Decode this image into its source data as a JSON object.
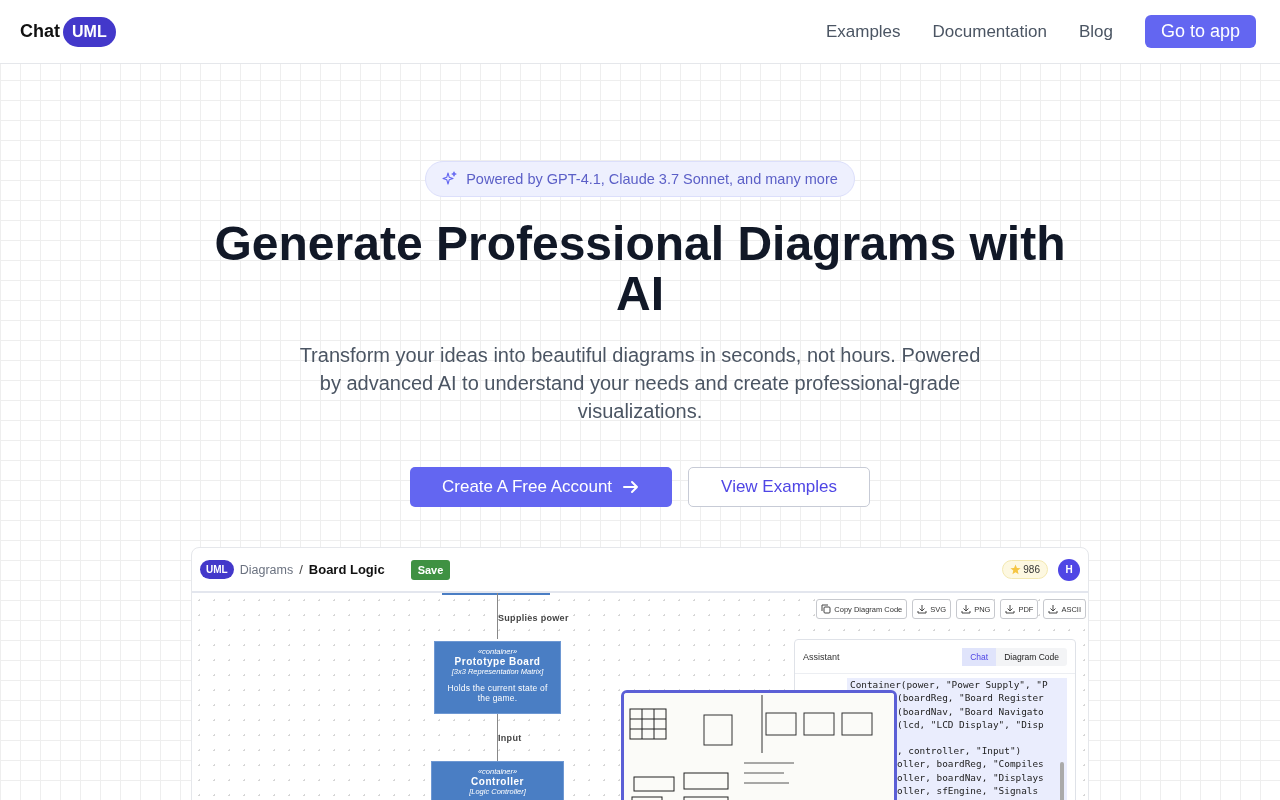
{
  "header": {
    "logo": {
      "word": "Chat",
      "badge": "UML"
    },
    "nav": [
      {
        "label": "Examples"
      },
      {
        "label": "Documentation"
      },
      {
        "label": "Blog"
      }
    ],
    "cta": "Go to app"
  },
  "hero": {
    "badge": "Powered by GPT-4.1, Claude 3.7 Sonnet, and many more",
    "title": "Generate Professional Diagrams with AI",
    "subtitle": "Transform your ideas into beautiful diagrams in seconds, not hours. Powered by advanced AI to understand your needs and create professional-grade visualizations.",
    "primary_button": "Create A Free Account",
    "secondary_button": "View Examples"
  },
  "preview": {
    "logo": "UML",
    "breadcrumb": "Diagrams",
    "separator": "/",
    "title": "Board Logic",
    "save": "Save",
    "credits": "986",
    "avatar": "H",
    "toolbar": [
      {
        "kind": "copy",
        "label": "Copy Diagram Code"
      },
      {
        "kind": "download",
        "label": "SVG"
      },
      {
        "kind": "download",
        "label": "PNG"
      },
      {
        "kind": "download",
        "label": "PDF"
      },
      {
        "kind": "download",
        "label": "ASCII"
      }
    ],
    "diagram": {
      "edges": [
        "Supplies power",
        "Input"
      ],
      "nodes": [
        {
          "stereotype": "«container»",
          "name": "Prototype Board",
          "tech": "[3x3 Representation Matrix]",
          "description": "Holds the current state of the game."
        },
        {
          "stereotype": "«container»",
          "name": "Controller",
          "tech": "[Logic Controller]"
        }
      ]
    },
    "assistant": {
      "title": "Assistant",
      "tabs": [
        {
          "label": "Chat",
          "selected": true
        },
        {
          "label": "Diagram Code",
          "selected": false
        }
      ],
      "code_blocks": [
        [
          "Container(power, \"Power Supply\", \"P",
          "(boardReg, \"Board Register",
          "(boardNav, \"Board Navigato",
          "(lcd, \"LCD Display\", \"Disp"
        ],
        [
          ", controller, \"Input\")",
          "oller, boardReg, \"Compiles",
          "oller, boardNav, \"Displays",
          "oller, sfEngine, \"Signals"
        ]
      ]
    }
  }
}
